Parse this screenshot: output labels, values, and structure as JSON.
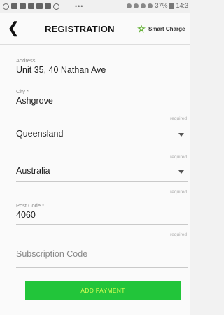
{
  "status_bar": {
    "time": "14:3",
    "battery": "37%",
    "dots": "•••"
  },
  "header": {
    "back_icon": "chevron-left-icon",
    "title": "REGISTRATION",
    "logo_text": "Smart Charge",
    "logo_color": "#6ab43e"
  },
  "form": {
    "address": {
      "label": "Address",
      "value": "Unit 35, 40 Nathan Ave"
    },
    "city": {
      "label": "City *",
      "value": "Ashgrove"
    },
    "state": {
      "required": "required",
      "value": "Queensland"
    },
    "country": {
      "required": "required",
      "value": "Australia"
    },
    "postcode": {
      "required": "required",
      "label": "Post Code *",
      "value": "4060"
    },
    "subscription": {
      "required": "required",
      "placeholder": "Subscription Code"
    },
    "add_payment": "ADD PAYMENT"
  },
  "colors": {
    "button_bg": "#22c53a",
    "button_text": "#d8ff55"
  }
}
